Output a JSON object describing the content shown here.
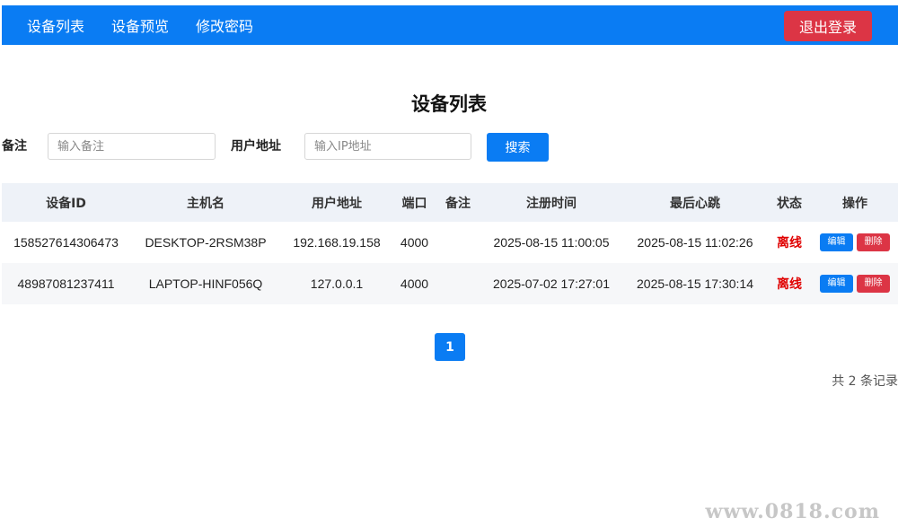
{
  "nav": {
    "items": [
      "设备列表",
      "设备预览",
      "修改密码"
    ],
    "logout_label": "退出登录"
  },
  "page": {
    "title": "设备列表"
  },
  "filters": {
    "remark_label": "备注",
    "remark_placeholder": "输入备注",
    "address_label": "用户地址",
    "address_placeholder": "输入IP地址",
    "search_label": "搜索"
  },
  "table": {
    "headers": [
      "设备ID",
      "主机名",
      "用户地址",
      "端口",
      "备注",
      "注册时间",
      "最后心跳",
      "状态",
      "操作"
    ],
    "rows": [
      {
        "device_id": "158527614306473",
        "hostname": "DESKTOP-2RSM38P",
        "address": "192.168.19.158",
        "port": "4000",
        "remark": "",
        "registered": "2025-08-15 11:00:05",
        "heartbeat": "2025-08-15 11:02:26",
        "status": "离线"
      },
      {
        "device_id": "48987081237411",
        "hostname": "LAPTOP-HINF056Q",
        "address": "127.0.0.1",
        "port": "4000",
        "remark": "",
        "registered": "2025-07-02 17:27:01",
        "heartbeat": "2025-08-15 17:30:14",
        "status": "离线"
      }
    ],
    "edit_label": "编辑",
    "delete_label": "删除"
  },
  "pagination": {
    "current_page": "1",
    "record_count_text": "共 2 条记录"
  },
  "watermark": "www.0818.com",
  "colors": {
    "primary": "#0a7cf3",
    "danger": "#dc3545",
    "offline": "#e00000",
    "header_bg": "#eef2f8"
  }
}
